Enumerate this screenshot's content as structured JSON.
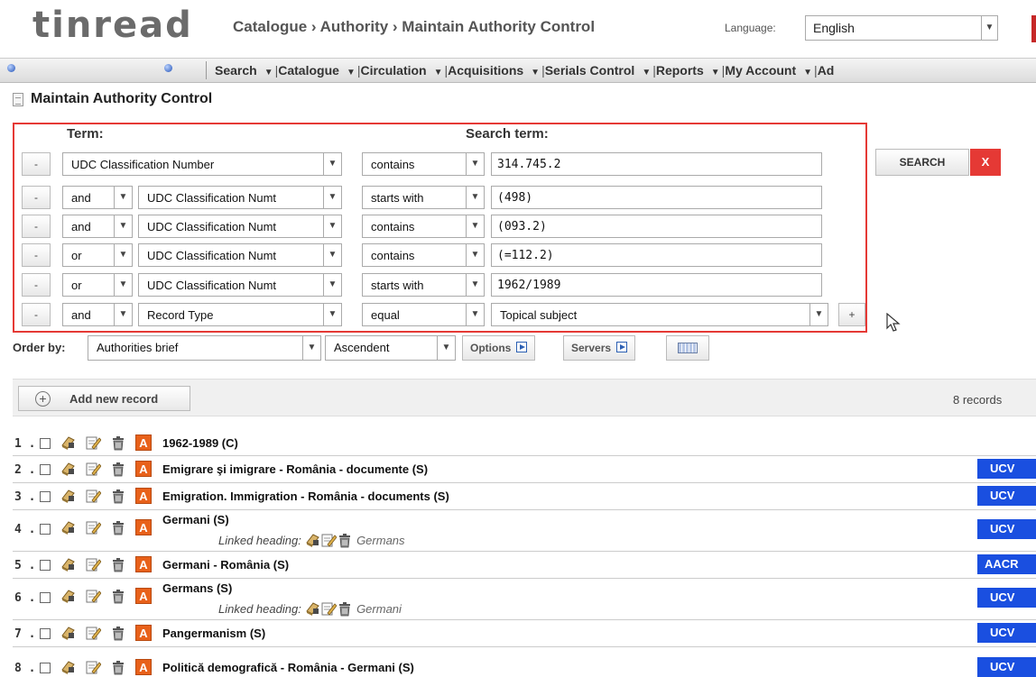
{
  "app": {
    "logo": "tinread"
  },
  "header": {
    "breadcrumb": "Catalogue › Authority › Maintain Authority Control",
    "language_label": "Language:",
    "language_value": "English"
  },
  "navbar": {
    "items": [
      "Search",
      "Catalogue",
      "Circulation",
      "Acquisitions",
      "Serials Control",
      "Reports",
      "My Account",
      "Ad"
    ]
  },
  "page": {
    "title": "Maintain Authority Control"
  },
  "search": {
    "term_header": "Term:",
    "search_term_header": "Search term:",
    "rows": [
      {
        "minus": "-",
        "term": "UDC Classification Number",
        "operator": "contains",
        "value": "314.745.2"
      },
      {
        "minus": "-",
        "logic": "and",
        "term": "UDC Classification Numt",
        "operator": "starts with",
        "value": "(498)"
      },
      {
        "minus": "-",
        "logic": "and",
        "term": "UDC Classification Numt",
        "operator": "contains",
        "value": "(093.2)"
      },
      {
        "minus": "-",
        "logic": "or",
        "term": "UDC Classification Numt",
        "operator": "contains",
        "value": "(=112.2)"
      },
      {
        "minus": "-",
        "logic": "or",
        "term": "UDC Classification Numt",
        "operator": "starts with",
        "value": "1962/1989"
      },
      {
        "minus": "-",
        "logic": "and",
        "term": "Record Type",
        "operator": "equal",
        "value": "Topical subject",
        "plus": "+"
      }
    ],
    "search_button": "SEARCH",
    "clear_button": "X"
  },
  "order": {
    "label": "Order by:",
    "field": "Authorities brief",
    "direction": "Ascendent",
    "options_button": "Options",
    "servers_button": "Servers"
  },
  "results": {
    "add_button": "Add new record",
    "count_text": "8 records",
    "linked_label": "Linked heading:",
    "items": [
      {
        "num": "1 .",
        "title": "1962-1989 (C)",
        "tag": ""
      },
      {
        "num": "2 .",
        "title": "Emigrare şi imigrare - România - documente (S)",
        "tag": "UCV"
      },
      {
        "num": "3 .",
        "title": "Emigration. Immigration - România - documents (S)",
        "tag": "UCV"
      },
      {
        "num": "4 .",
        "title": "Germani (S)",
        "linked": "Germans",
        "tag": "UCV"
      },
      {
        "num": "5 .",
        "title": "Germani - România (S)",
        "tag": "AACR"
      },
      {
        "num": "6 .",
        "title": "Germans (S)",
        "linked": "Germani",
        "tag": "UCV"
      },
      {
        "num": "7 .",
        "title": "Pangermanism (S)",
        "tag": "UCV"
      },
      {
        "num": "8 .",
        "title": "Politică demografică - România - Germani (S)",
        "tag": "UCV"
      }
    ]
  },
  "colors": {
    "accent_red": "#e53935",
    "tag_blue": "#1a4fe0",
    "authority_orange": "#e8611a"
  },
  "icons": [
    "record-icon",
    "edit-icon",
    "trash-icon",
    "authority-icon",
    "add-circle-icon",
    "keyboard-icon",
    "play-icon",
    "cursor-icon"
  ]
}
